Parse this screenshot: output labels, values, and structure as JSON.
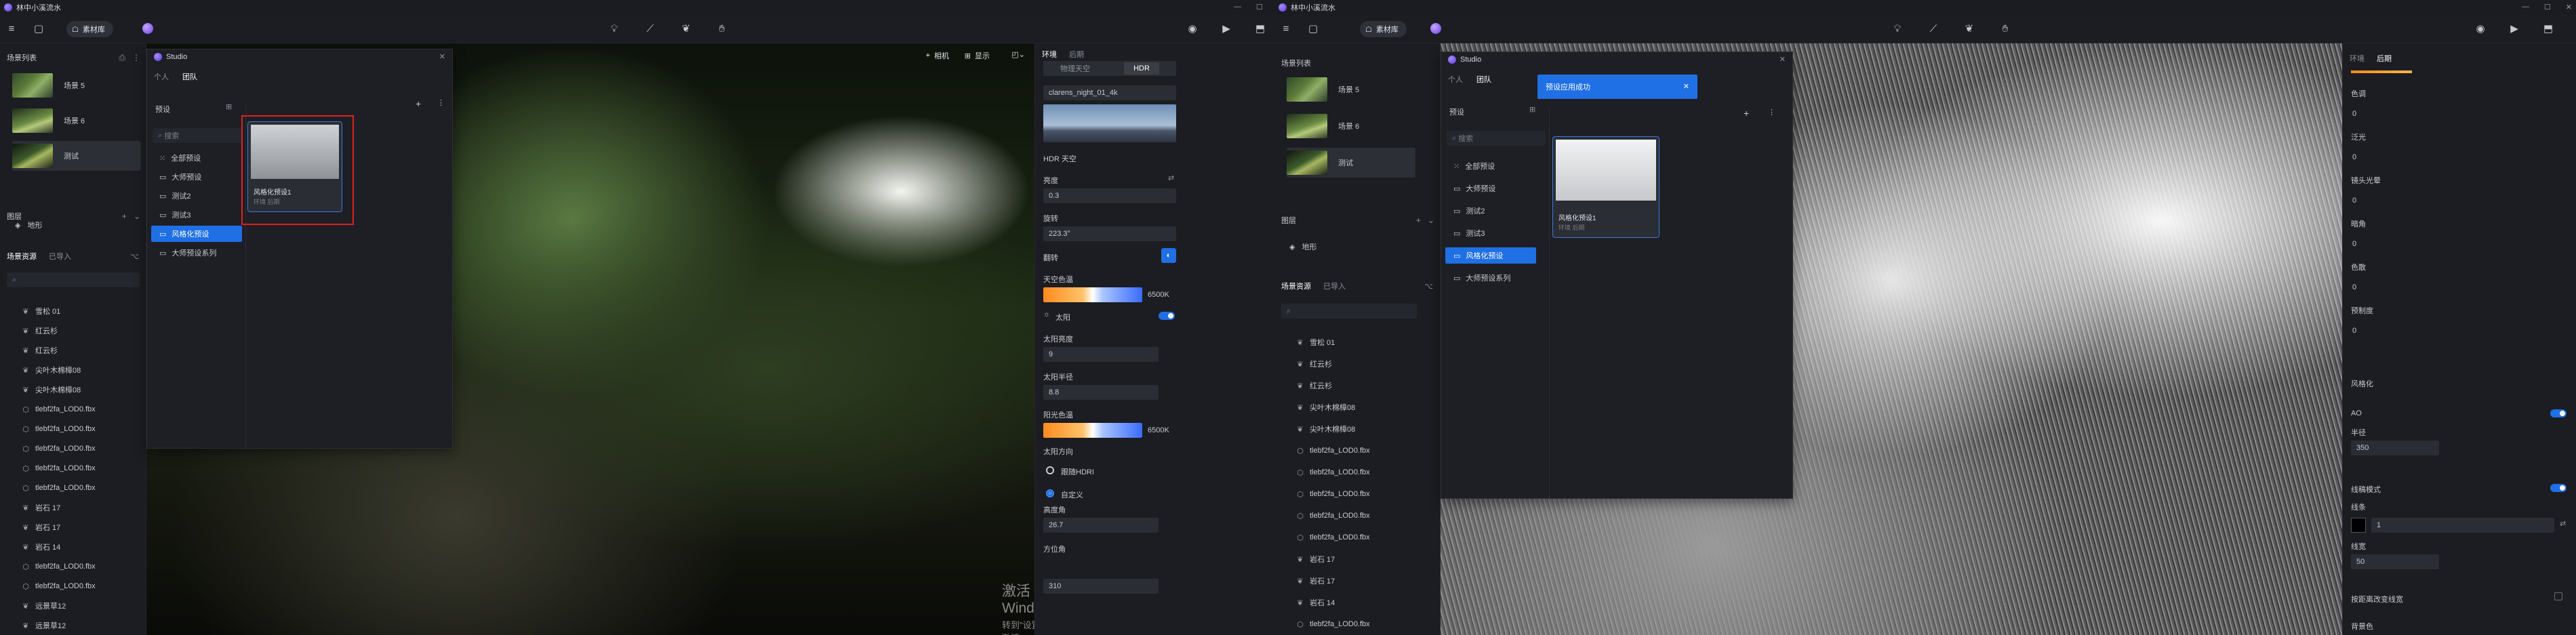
{
  "window_left": {
    "title": "林中小溪流水",
    "toolbar": {
      "pill_label": "素材库"
    },
    "viewport_tools": {
      "camera": "相机",
      "display": "显示"
    },
    "watermark": {
      "line1": "激活 Windows",
      "line2": "转到\"设置\"以激活 Windows。"
    },
    "scene_list": {
      "title": "场景列表",
      "items": [
        {
          "label": "场景 5"
        },
        {
          "label": "场景 6"
        },
        {
          "label": "测试"
        }
      ]
    },
    "layers": {
      "title": "图层",
      "items": [
        {
          "label": "地形"
        }
      ]
    },
    "assets": {
      "tabs": [
        "场景资源",
        "已导入"
      ],
      "search_placeholder": "",
      "items": [
        "雪松 01",
        "红云杉",
        "红云杉",
        "尖叶木棉樟08",
        "尖叶木棉樟08",
        "tlebf2fa_LOD0.fbx",
        "tlebf2fa_LOD0.fbx",
        "tlebf2fa_LOD0.fbx",
        "tlebf2fa_LOD0.fbx",
        "tlebf2fa_LOD0.fbx",
        "岩石 17",
        "岩石 17",
        "岩石 14",
        "tlebf2fa_LOD0.fbx",
        "tlebf2fa_LOD0.fbx",
        "远景草12",
        "远景草12"
      ]
    },
    "studio": {
      "title": "Studio",
      "tabs": [
        "个人",
        "团队"
      ],
      "section": "预设",
      "search_placeholder": "搜索",
      "folders": [
        "全部预设",
        "大师预设",
        "测试2",
        "测试3",
        "风格化预设",
        "大师预设系列"
      ],
      "selected_folder_index": 4,
      "card": {
        "name": "风格化预设1",
        "sub": "环境 后期"
      }
    },
    "right_panel": {
      "tabs": [
        "环境",
        "后期"
      ],
      "sub_tabs": [
        "物理天空",
        "HDR"
      ],
      "hdr_name": "clarens_night_01_4k",
      "hdr_sky_label": "HDR 天空",
      "brightness_label": "亮度",
      "brightness_value": "0.3",
      "rotation_label": "旋转",
      "rotation_value": "223.3°",
      "flip_label": "翻转",
      "sky_color_label": "天空色温",
      "sky_color_value": "6500K",
      "sun_label": "太阳",
      "sun_brightness_label": "太阳亮度",
      "sun_brightness_value": "9",
      "sun_radius_label": "太阳半径",
      "sun_radius_value": "8.8",
      "sun_color_label": "阳光色温",
      "sun_color_value": "6500K",
      "sun_dir_label": "太阳方向",
      "dir_opt1": "跟随HDRI",
      "dir_opt2": "自定义",
      "altitude_label": "高度角",
      "altitude_value": "26.7",
      "azimuth_label": "方位角",
      "azimuth_value": "310"
    }
  },
  "window_right": {
    "title": "林中小溪流水",
    "toolbar": {
      "pill_label": "素材库"
    },
    "toast": "预设应用成功",
    "scene_list": {
      "title": "场景列表",
      "items": [
        {
          "label": "场景 5"
        },
        {
          "label": "场景 6"
        },
        {
          "label": "测试"
        }
      ]
    },
    "layers": {
      "title": "图层",
      "items": [
        {
          "label": "地形"
        }
      ]
    },
    "assets": {
      "tabs": [
        "场景资源",
        "已导入"
      ],
      "items": [
        "雪松 01",
        "红云杉",
        "红云杉",
        "尖叶木棉樟08",
        "尖叶木棉樟08",
        "tlebf2fa_LOD0.fbx",
        "tlebf2fa_LOD0.fbx",
        "tlebf2fa_LOD0.fbx",
        "tlebf2fa_LOD0.fbx",
        "tlebf2fa_LOD0.fbx",
        "岩石 17",
        "岩石 17",
        "岩石 14",
        "tlebf2fa_LOD0.fbx"
      ]
    },
    "studio": {
      "title": "Studio",
      "tabs": [
        "个人",
        "团队"
      ],
      "section": "预设",
      "search_placeholder": "搜索",
      "folders": [
        "全部预设",
        "大师预设",
        "测试2",
        "测试3",
        "风格化预设",
        "大师预设系列"
      ],
      "card": {
        "name": "风格化预设1",
        "sub": "环境 后期"
      }
    },
    "right_panel": {
      "tabs": [
        "环境",
        "后期"
      ],
      "hue_label": "色调",
      "hue_value": "0",
      "gloss_label": "泛光",
      "gloss_value": "0",
      "lens_label": "镜头光晕",
      "lens_value": "0",
      "dark_label": "暗角",
      "dark_value": "0",
      "chroma_label": "色散",
      "chroma_value": "0",
      "sharp_label": "预制度",
      "sharp_value": "0",
      "style_label": "风格化",
      "ao_label": "AO",
      "radius_label": "半径",
      "radius_value": "350",
      "line_mode_label": "线稿模式",
      "line_color_label": "线条",
      "line_opacity_value": "1",
      "line_width_label": "线宽",
      "line_width_value": "50",
      "high_label": "按距离改变线宽",
      "bg_label": "背景色"
    }
  }
}
